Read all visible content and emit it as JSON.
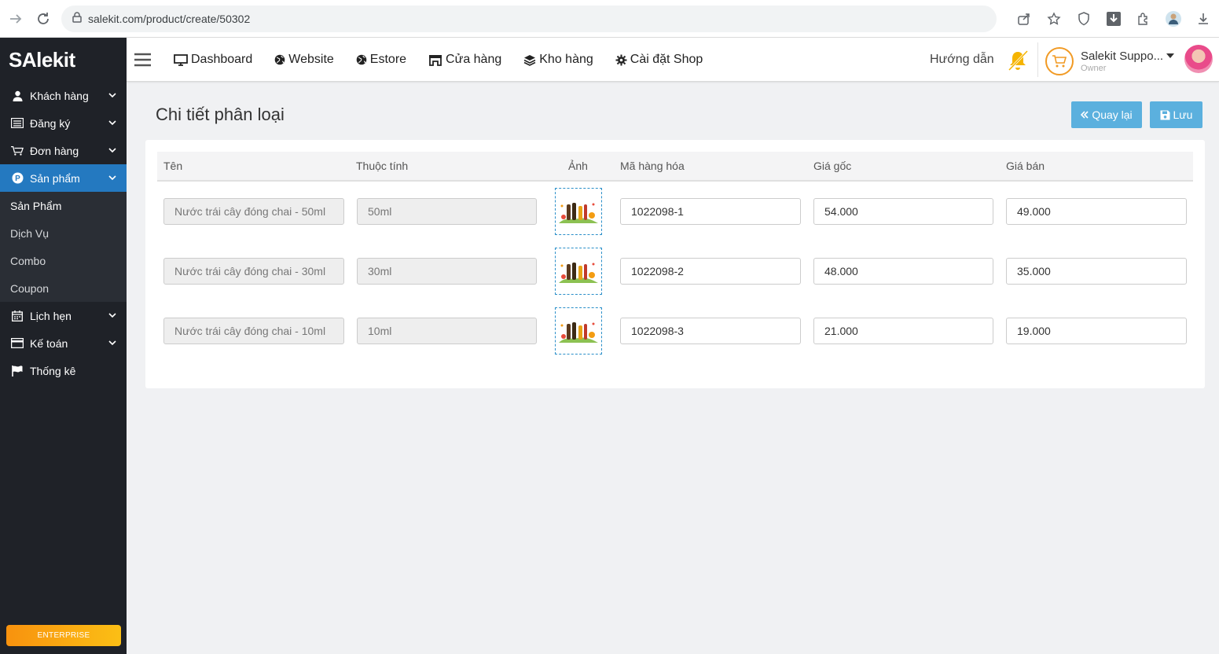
{
  "browser": {
    "url": "salekit.com/product/create/50302"
  },
  "sidebar": {
    "logo": "SAlekit",
    "items": [
      {
        "label": "Khách hàng",
        "icon": "user-icon"
      },
      {
        "label": "Đăng ký",
        "icon": "list-icon"
      },
      {
        "label": "Đơn hàng",
        "icon": "cart-icon"
      },
      {
        "label": "Sản phẩm",
        "icon": "product-icon"
      },
      {
        "label": "Lịch hẹn",
        "icon": "calendar-icon"
      },
      {
        "label": "Kế toán",
        "icon": "credit-card-icon"
      },
      {
        "label": "Thống kê",
        "icon": "flag-icon"
      }
    ],
    "submenu": [
      "Sản Phẩm",
      "Dịch Vụ",
      "Combo",
      "Coupon"
    ],
    "badge": "ENTERPRISE"
  },
  "topnav": {
    "items": [
      {
        "label": "Dashboard",
        "icon": "monitor-icon"
      },
      {
        "label": "Website",
        "icon": "globe-icon"
      },
      {
        "label": "Estore",
        "icon": "globe-icon"
      },
      {
        "label": "Cửa hàng",
        "icon": "store-icon"
      },
      {
        "label": "Kho hàng",
        "icon": "layers-icon"
      },
      {
        "label": "Cài đặt Shop",
        "icon": "gear-icon"
      }
    ],
    "help": "Hướng dẫn",
    "user_name": "Salekit Suppo...",
    "user_role": "Owner"
  },
  "page": {
    "title": "Chi tiết phân loại",
    "back_label": "Quay lại",
    "save_label": "Lưu"
  },
  "table": {
    "headers": [
      "Tên",
      "Thuộc tính",
      "Ảnh",
      "Mã hàng hóa",
      "Giá gốc",
      "Giá bán"
    ],
    "rows": [
      {
        "name": "Nước trái cây đóng chai - 50ml",
        "attr": "50ml",
        "sku": "1022098-1",
        "cost": "54.000",
        "price": "49.000"
      },
      {
        "name": "Nước trái cây đóng chai - 30ml",
        "attr": "30ml",
        "sku": "1022098-2",
        "cost": "48.000",
        "price": "35.000"
      },
      {
        "name": "Nước trái cây đóng chai - 10ml",
        "attr": "10ml",
        "sku": "1022098-3",
        "cost": "21.000",
        "price": "19.000"
      }
    ]
  },
  "colors": {
    "sidebar_bg": "#1f2228",
    "active_menu": "#2479c0",
    "button": "#5bb0de",
    "accent_orange": "#f19a24"
  }
}
